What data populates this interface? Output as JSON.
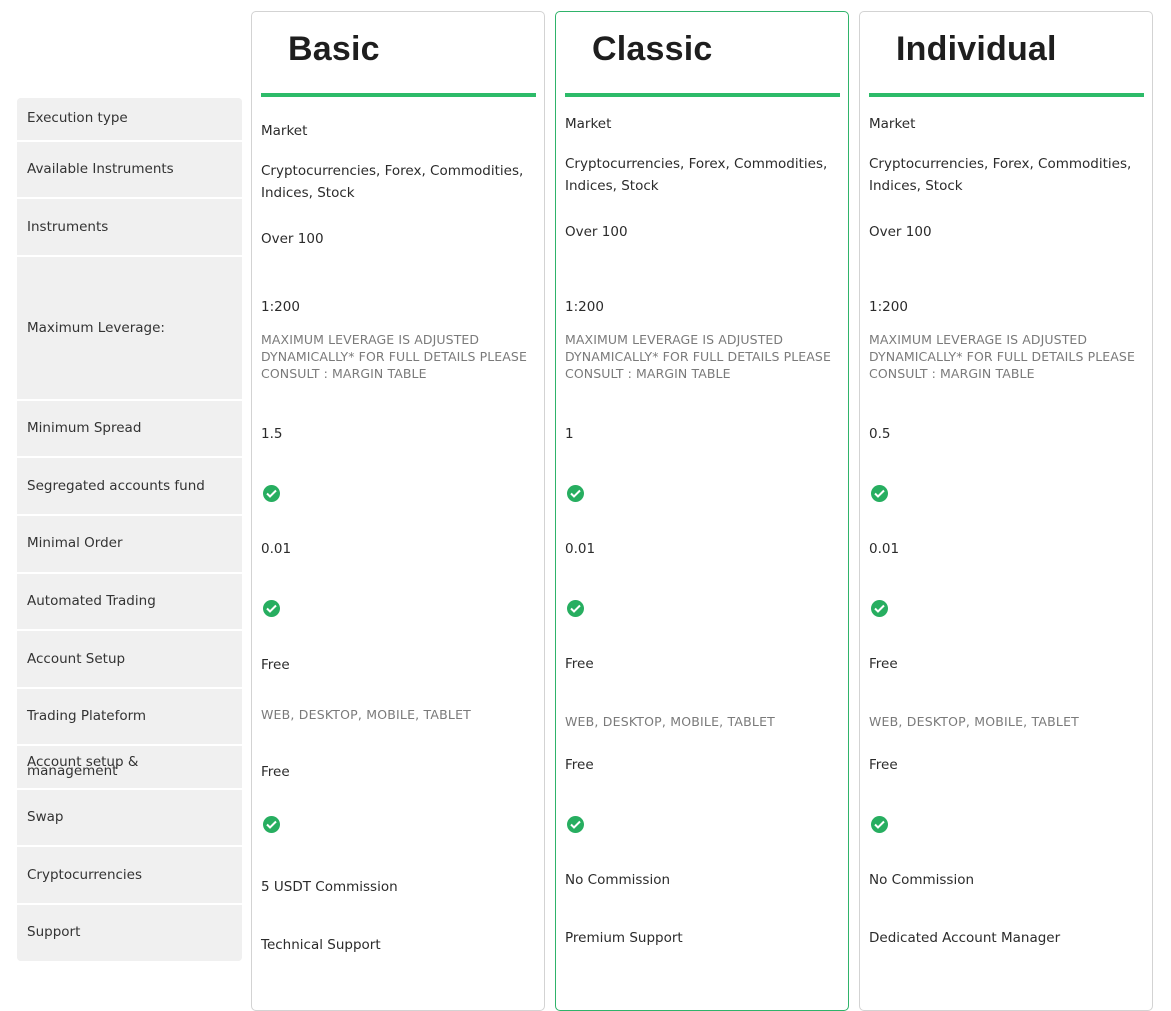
{
  "features": [
    "Execution type",
    "Available Instruments",
    "Instruments",
    "Maximum Leverage:",
    "Minimum Spread",
    "Segregated accounts fund",
    "Minimal Order",
    "Automated Trading",
    "Account Setup",
    "Trading Plateform",
    "Account setup & management",
    "Swap",
    "Cryptocurrencies",
    "Support"
  ],
  "accent_color": "#2dbb69",
  "plans": [
    {
      "name": "Basic",
      "featured": false,
      "execution_type": "Market",
      "available_instruments": "Cryptocurrencies, Forex, Commodities, Indices, Stock",
      "instruments": "Over 100",
      "max_leverage": "1:200",
      "leverage_note": "MAXIMUM LEVERAGE IS ADJUSTED DYNAMICALLY* FOR FULL DETAILS PLEASE CONSULT : MARGIN TABLE",
      "min_spread": "1.5",
      "segregated_accounts_fund": "check-icon",
      "minimal_order": "0.01",
      "automated_trading": "check-icon",
      "account_setup": "Free",
      "trading_platform": "WEB, DESKTOP, MOBILE, TABLET",
      "account_setup_management": "Free",
      "swap": "check-icon",
      "cryptocurrencies": "5 USDT Commission",
      "support": "Technical Support"
    },
    {
      "name": "Classic",
      "featured": true,
      "execution_type": "Market",
      "available_instruments": "Cryptocurrencies, Forex, Commodities, Indices, Stock",
      "instruments": "Over 100",
      "max_leverage": "1:200",
      "leverage_note": "MAXIMUM LEVERAGE IS ADJUSTED DYNAMICALLY* FOR FULL DETAILS PLEASE CONSULT : MARGIN TABLE",
      "min_spread": "1",
      "segregated_accounts_fund": "check-icon",
      "minimal_order": "0.01",
      "automated_trading": "check-icon",
      "account_setup": "Free",
      "trading_platform": "WEB, DESKTOP, MOBILE, TABLET",
      "account_setup_management": "Free",
      "swap": "check-icon",
      "cryptocurrencies": "No Commission",
      "support": "Premium Support"
    },
    {
      "name": "Individual",
      "featured": false,
      "execution_type": "Market",
      "available_instruments": "Cryptocurrencies, Forex, Commodities, Indices, Stock",
      "instruments": "Over 100",
      "max_leverage": "1:200",
      "leverage_note": "MAXIMUM LEVERAGE IS ADJUSTED DYNAMICALLY* FOR FULL DETAILS PLEASE CONSULT : MARGIN TABLE",
      "min_spread": "0.5",
      "segregated_accounts_fund": "check-icon",
      "minimal_order": "0.01",
      "automated_trading": "check-icon",
      "account_setup": "Free",
      "trading_platform": "WEB, DESKTOP, MOBILE, TABLET",
      "account_setup_management": "Free",
      "swap": "check-icon",
      "cryptocurrencies": "No Commission",
      "support": "Dedicated Account Manager"
    }
  ]
}
